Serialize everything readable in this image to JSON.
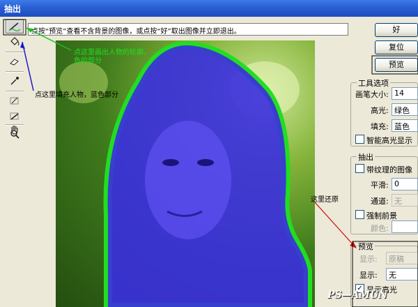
{
  "window": {
    "title": "抽出"
  },
  "hint": "点按“预览”查看不含背景的图像，或点按“好”取出图像并立即退出。",
  "tools": [
    {
      "icon": "edge-highlighter-icon"
    },
    {
      "icon": "fill-bucket-icon"
    },
    {
      "icon": "eraser-icon"
    },
    {
      "icon": "eyedropper-icon"
    },
    {
      "icon": "cleanup-tool-icon"
    },
    {
      "icon": "edge-touchup-icon"
    },
    {
      "icon": "zoom-icon"
    },
    {
      "icon": "hand-icon"
    }
  ],
  "buttons": {
    "ok": "好",
    "reset": "复位",
    "preview": "预览"
  },
  "tool_options": {
    "title": "工具选项",
    "brush_size_label": "画笔大小:",
    "brush_size_value": "14",
    "highlight_label": "高光:",
    "highlight_value": "绿色",
    "fill_label": "填充:",
    "fill_value": "蓝色",
    "smart_highlight_label": "智能高光显示"
  },
  "extraction": {
    "title": "抽出",
    "textured_label": "带纹理的图像",
    "smooth_label": "平滑:",
    "smooth_value": "0",
    "channel_label": "通道:",
    "channel_value": "无",
    "force_fg_label": "强制前景",
    "color_label": "颜色:"
  },
  "preview": {
    "title": "预览",
    "show_label_1": "显示:",
    "show_value_1": "原稿",
    "show_label_2": "显示:",
    "show_value_2": "无",
    "show_highlight_label": "显示高光"
  },
  "annotations": {
    "outline": "点这里画出人物的轮廓，\n色的部分",
    "fill": "点这里填充人物，蓝色部分",
    "restore": "这里还原"
  },
  "watermark": "PS—AMUN",
  "colors": {
    "highlight_green": "#22dd22",
    "fill_blue": "#3a2ee0",
    "arrow_blue": "#1a1acc",
    "arrow_red": "#cc1111",
    "titlebar": "#2a5fd4"
  }
}
